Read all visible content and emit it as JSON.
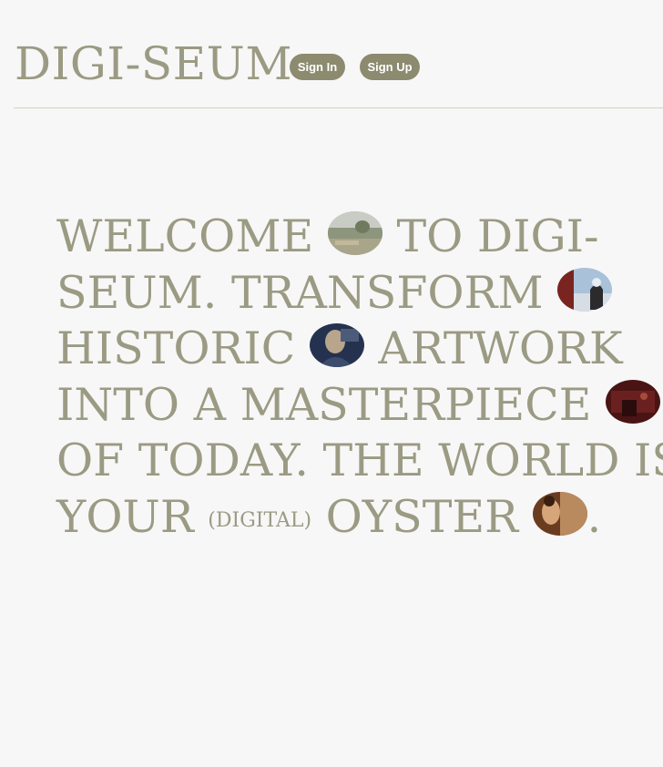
{
  "header": {
    "logo": "DIGI-SEUM",
    "sign_in_label": "Sign In",
    "sign_up_label": "Sign Up"
  },
  "hero": {
    "line1_a": "WELCOME",
    "line1_b": "TO DIGI-",
    "line2_a": "SEUM. TRANSFORM",
    "line3_a": "HISTORIC",
    "line3_b": "ARTWORK",
    "line4_a": "INTO A MASTERPIECE",
    "line5_a": "OF TODAY. THE WORLD IS",
    "line6_a": "YOUR",
    "line6_small": "(DIGITAL)",
    "line6_b": "OYSTER",
    "line6_end": "."
  },
  "colors": {
    "text": "#9b9a83",
    "button_bg": "#8c8a6f",
    "background": "#f7f7f7"
  }
}
